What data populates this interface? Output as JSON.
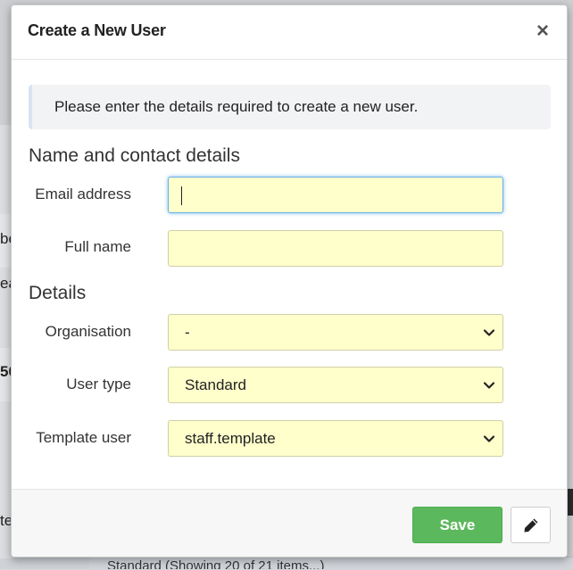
{
  "background": {
    "fragments": [
      {
        "text": "be",
        "bold": false
      },
      {
        "text": "ea",
        "bold": false
      },
      {
        "text": "50",
        "bold": true
      },
      {
        "text": "te",
        "bold": false
      }
    ],
    "bottom_text": "Standard (Showing 20 of 21 items...)"
  },
  "modal": {
    "title": "Create a New User",
    "close_label": "×",
    "info_text": "Please enter the details required to create a new user.",
    "sections": {
      "contact": "Name and contact details",
      "details": "Details"
    },
    "fields": {
      "email": {
        "label": "Email address",
        "value": ""
      },
      "full_name": {
        "label": "Full name",
        "value": ""
      },
      "organisation": {
        "label": "Organisation",
        "value": "-"
      },
      "user_type": {
        "label": "User type",
        "value": "Standard"
      },
      "template_user": {
        "label": "Template user",
        "value": "staff.template"
      }
    },
    "footer": {
      "save_label": "Save"
    }
  },
  "colors": {
    "field_background": "#ffffcc",
    "save_button": "#5cb85c",
    "focus_border": "#66afe9"
  },
  "icons": {
    "close": "close-icon",
    "chevron": "chevron-down-icon",
    "edit": "pencil-icon"
  }
}
